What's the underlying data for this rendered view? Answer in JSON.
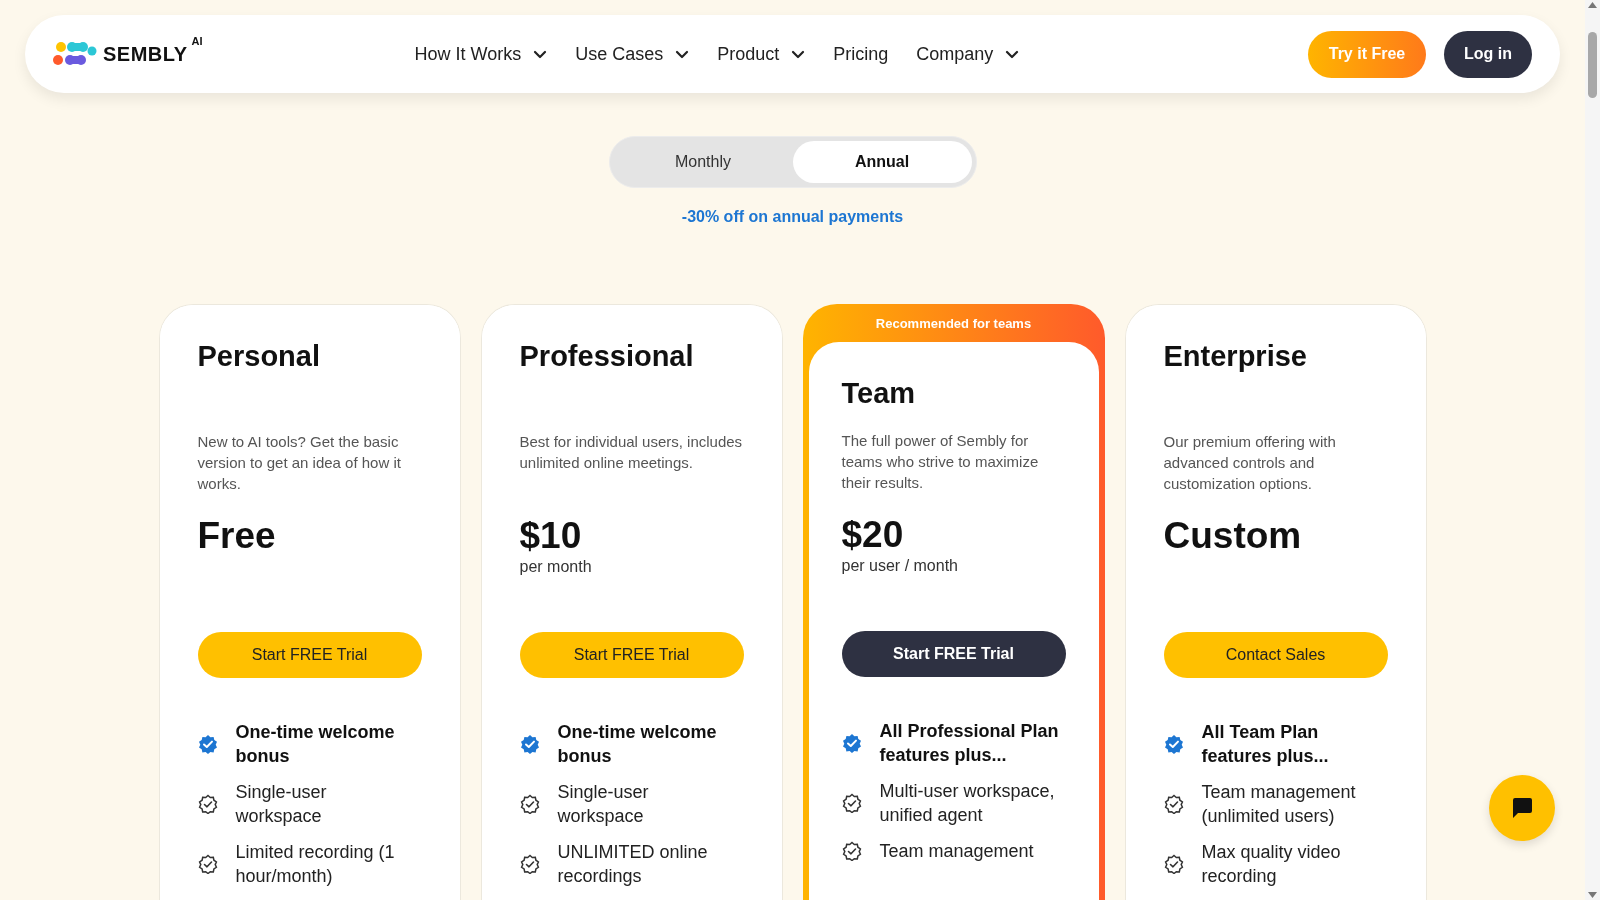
{
  "header": {
    "logo": {
      "name": "SEMBLY",
      "badge": "AI"
    },
    "nav": [
      {
        "label": "How It Works",
        "has_menu": true
      },
      {
        "label": "Use Cases",
        "has_menu": true
      },
      {
        "label": "Product",
        "has_menu": true
      },
      {
        "label": "Pricing",
        "has_menu": false
      },
      {
        "label": "Company",
        "has_menu": true
      }
    ],
    "actions": [
      {
        "label": "Try it Free",
        "kind": "gradient"
      },
      {
        "label": "Log in",
        "kind": "dark"
      }
    ]
  },
  "billing": {
    "options": [
      {
        "label": "Monthly",
        "selected": false
      },
      {
        "label": "Annual",
        "selected": true
      }
    ],
    "discount": "-30% off on annual payments"
  },
  "plans": [
    {
      "name": "Personal",
      "description": "New to AI tools? Get the basic version to get an idea of how it works.",
      "price": "Free",
      "button": {
        "label": "Start FREE Trial",
        "kind": "yellow"
      },
      "features": [
        {
          "kind": "bonus",
          "text": "One-time welcome bonus"
        },
        {
          "kind": "standard",
          "text": "Single-user workspace"
        },
        {
          "kind": "standard",
          "text": "Limited recording (1 hour/month)"
        }
      ]
    },
    {
      "name": "Professional",
      "description": "Best for individual users, includes unlimited online meetings.",
      "price": "$10",
      "price_note": "per month",
      "button": {
        "label": "Start FREE Trial",
        "kind": "yellow"
      },
      "features": [
        {
          "kind": "bonus",
          "text": "One-time welcome bonus"
        },
        {
          "kind": "standard",
          "text": "Single-user workspace"
        },
        {
          "kind": "standard",
          "text": "UNLIMITED online recordings"
        }
      ]
    },
    {
      "name": "Team",
      "ribbon": "Recommended for teams",
      "description": "The full power of Sembly for teams who strive to maximize their results.",
      "price": "$20",
      "price_note": "per user / month",
      "button": {
        "label": "Start FREE Trial",
        "kind": "dark"
      },
      "features": [
        {
          "kind": "bonus",
          "text": "All Professional Plan features plus..."
        },
        {
          "kind": "standard",
          "text": "Multi-user workspace, unified agent"
        },
        {
          "kind": "standard",
          "text": "Team management"
        }
      ]
    },
    {
      "name": "Enterprise",
      "description": "Our premium offering with advanced controls and customization options.",
      "price": "Custom",
      "button": {
        "label": "Contact Sales",
        "kind": "yellow"
      },
      "features": [
        {
          "kind": "bonus",
          "text": "All Team Plan features plus..."
        },
        {
          "kind": "standard",
          "text": "Team management (unlimited users)"
        },
        {
          "kind": "standard",
          "text": "Max quality video recording"
        }
      ]
    }
  ]
}
